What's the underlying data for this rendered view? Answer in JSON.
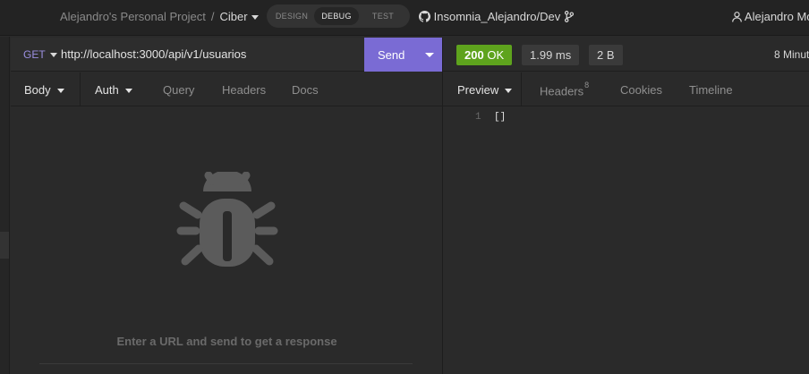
{
  "header": {
    "project": "Alejandro's Personal Project",
    "separator": "/",
    "collection": "Ciber",
    "modes": [
      "DESIGN",
      "DEBUG",
      "TEST"
    ],
    "active_mode": "DEBUG",
    "git_repo": "Insomnia_Alejandro/Dev",
    "user": "Alejandro Mo"
  },
  "request": {
    "method": "GET",
    "url": "http://localhost:3000/api/v1/usuarios",
    "send_label": "Send",
    "tabs": [
      "Body",
      "Auth",
      "Query",
      "Headers",
      "Docs"
    ],
    "empty_message": "Enter a URL and send to get a response"
  },
  "response": {
    "status_code": "200",
    "status_text": "OK",
    "time": "1.99 ms",
    "size": "2 B",
    "received": "8 Minut",
    "tabs": [
      "Preview",
      "Headers",
      "Cookies",
      "Timeline"
    ],
    "headers_count": "8",
    "body_lines": [
      {
        "num": "1",
        "text": "[]"
      }
    ]
  },
  "colors": {
    "accent": "#7a6bd4",
    "status_ok": "#5ea31d",
    "method": "#9b8fe0"
  }
}
